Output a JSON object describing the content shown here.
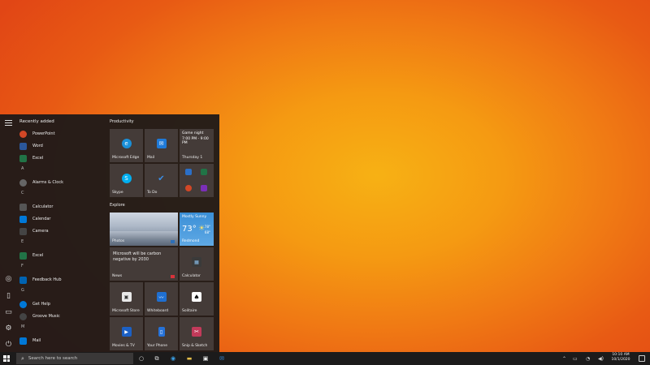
{
  "start_menu": {
    "recently_added_header": "Recently added",
    "apps": [
      {
        "label": "PowerPoint",
        "icon": "powerpoint-icon",
        "color": "#d24726"
      },
      {
        "label": "Word",
        "icon": "word-icon",
        "color": "#2b579a"
      },
      {
        "label": "Excel",
        "icon": "excel-icon",
        "color": "#217346"
      },
      {
        "letter": "A"
      },
      {
        "label": "Alarms & Clock",
        "icon": "alarms-icon",
        "color": "#666666"
      },
      {
        "letter": "C"
      },
      {
        "label": "Calculator",
        "icon": "calculator-icon",
        "color": "#555555"
      },
      {
        "label": "Calendar",
        "icon": "calendar-icon",
        "color": "#0078d7"
      },
      {
        "label": "Camera",
        "icon": "camera-icon",
        "color": "#444444"
      },
      {
        "letter": "E"
      },
      {
        "label": "Excel",
        "icon": "excel-icon",
        "color": "#217346"
      },
      {
        "letter": "F"
      },
      {
        "label": "Feedback Hub",
        "icon": "feedback-hub-icon",
        "color": "#0063b1"
      },
      {
        "letter": "G"
      },
      {
        "label": "Get Help",
        "icon": "get-help-icon",
        "color": "#0078d7"
      },
      {
        "label": "Groove Music",
        "icon": "groove-music-icon",
        "color": "#444444"
      },
      {
        "letter": "M"
      },
      {
        "label": "Mail",
        "icon": "mail-icon",
        "color": "#0078d7"
      }
    ],
    "productivity_header": "Productivity",
    "explore_header": "Explore",
    "tiles": {
      "edge": "Microsoft Edge",
      "mail": "Mail",
      "calendar_event": "Game night",
      "calendar_time": "7:00 PM - 9:00 PM",
      "calendar_date": "Thursday 1",
      "skype": "Skype",
      "todo": "To Do",
      "photos": "Photos",
      "weather_condition": "Mostly Sunny",
      "weather_temp": "73°",
      "weather_high": "78°",
      "weather_low": "68°",
      "weather_city": "Redmond",
      "news_headline": "Microsoft will be carbon negative by 2030",
      "news": "News",
      "calculator": "Calculator",
      "store": "Microsoft Store",
      "whiteboard": "Whiteboard",
      "solitaire": "Solitaire",
      "movies": "Movies & TV",
      "phone": "Your Phone",
      "snip": "Snip & Sketch"
    }
  },
  "taskbar": {
    "search_placeholder": "Search here to search",
    "time": "10:10 AM",
    "date": "10/1/2020"
  },
  "colors": {
    "accent": "#0078d7",
    "desktop_center": "#f7b114",
    "desktop_edge": "#e14615"
  }
}
